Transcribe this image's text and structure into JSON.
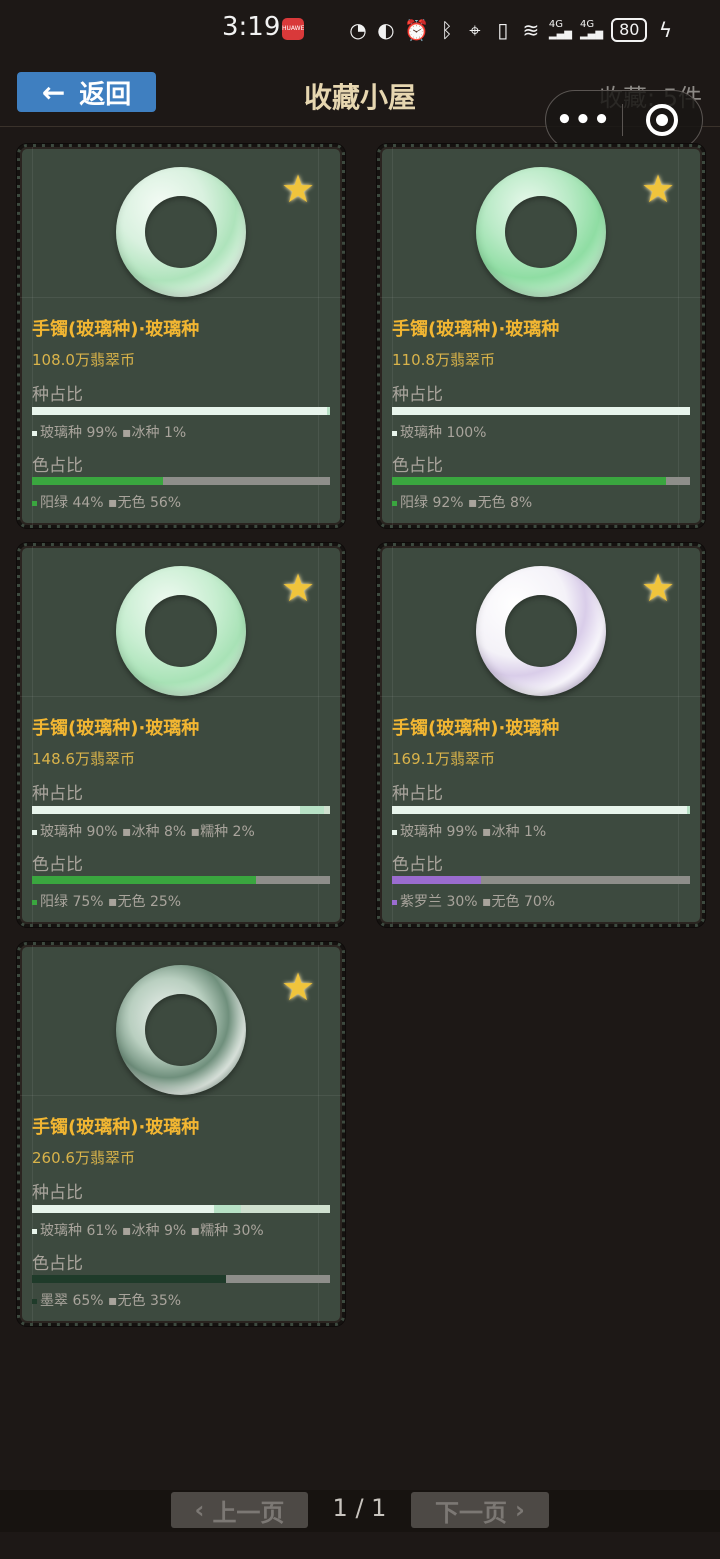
{
  "status_bar": {
    "time": "3:19",
    "app_badge": "HUAWEI",
    "battery": "80",
    "net1": "4G",
    "net2": "4G"
  },
  "header": {
    "back_label": "返回",
    "title": "收藏小屋",
    "count_text": "收藏: 5件"
  },
  "cards": [
    {
      "title": "手镯(玻璃种)·玻璃种",
      "price": "108.0万翡翠币",
      "zhong_label": "种占比",
      "zhong_legend": "玻璃种 99% ▪冰种 1%",
      "se_label": "色占比",
      "se_legend": "阳绿 44% ▪无色 56%",
      "zhong": [
        {
          "name": "玻璃种",
          "pct": 99,
          "color": "#e8f5ec"
        },
        {
          "name": "冰种",
          "pct": 1,
          "color": "#b8e2c6"
        }
      ],
      "se": [
        {
          "name": "阳绿",
          "pct": 44,
          "color": "#3aa63f"
        },
        {
          "name": "无色",
          "pct": 56,
          "color": "#8e8e8a"
        }
      ],
      "jade": "jade-green"
    },
    {
      "title": "手镯(玻璃种)·玻璃种",
      "price": "110.8万翡翠币",
      "zhong_label": "种占比",
      "zhong_legend": "玻璃种 100%",
      "se_label": "色占比",
      "se_legend": "阳绿 92% ▪无色 8%",
      "zhong": [
        {
          "name": "玻璃种",
          "pct": 100,
          "color": "#e8f5ec"
        }
      ],
      "se": [
        {
          "name": "阳绿",
          "pct": 92,
          "color": "#3aa63f"
        },
        {
          "name": "无色",
          "pct": 8,
          "color": "#8e8e8a"
        }
      ],
      "jade": "jade-green-strong"
    },
    {
      "title": "手镯(玻璃种)·玻璃种",
      "price": "148.6万翡翠币",
      "zhong_label": "种占比",
      "zhong_legend": "玻璃种 90% ▪冰种 8% ▪糯种 2%",
      "se_label": "色占比",
      "se_legend": "阳绿 75% ▪无色 25%",
      "zhong": [
        {
          "name": "玻璃种",
          "pct": 90,
          "color": "#e8f5ec"
        },
        {
          "name": "冰种",
          "pct": 8,
          "color": "#b8e2c6"
        },
        {
          "name": "糯种",
          "pct": 2,
          "color": "#cfe0cf"
        }
      ],
      "se": [
        {
          "name": "阳绿",
          "pct": 75,
          "color": "#3aa63f"
        },
        {
          "name": "无色",
          "pct": 25,
          "color": "#8e8e8a"
        }
      ],
      "jade": "jade-green-mid"
    },
    {
      "title": "手镯(玻璃种)·玻璃种",
      "price": "169.1万翡翠币",
      "zhong_label": "种占比",
      "zhong_legend": "玻璃种 99% ▪冰种 1%",
      "se_label": "色占比",
      "se_legend": "紫罗兰 30% ▪无色 70%",
      "zhong": [
        {
          "name": "玻璃种",
          "pct": 99,
          "color": "#e8f5ec"
        },
        {
          "name": "冰种",
          "pct": 1,
          "color": "#b8e2c6"
        }
      ],
      "se": [
        {
          "name": "紫罗兰",
          "pct": 30,
          "color": "#9a6ccf"
        },
        {
          "name": "无色",
          "pct": 70,
          "color": "#8e8e8a"
        }
      ],
      "jade": "jade-lavender"
    },
    {
      "title": "手镯(玻璃种)·玻璃种",
      "price": "260.6万翡翠币",
      "zhong_label": "种占比",
      "zhong_legend": "玻璃种 61% ▪冰种 9% ▪糯种 30%",
      "se_label": "色占比",
      "se_legend": "墨翠 65% ▪无色 35%",
      "zhong": [
        {
          "name": "玻璃种",
          "pct": 61,
          "color": "#e8f5ec"
        },
        {
          "name": "冰种",
          "pct": 9,
          "color": "#b8e2c6"
        },
        {
          "name": "糯种",
          "pct": 30,
          "color": "#cfe0cf"
        }
      ],
      "se": [
        {
          "name": "墨翠",
          "pct": 65,
          "color": "#1f3b2a"
        },
        {
          "name": "无色",
          "pct": 35,
          "color": "#8e8e8a"
        }
      ],
      "jade": "jade-dark"
    }
  ],
  "pager": {
    "prev_label": "上一页",
    "page_text": "1 / 1",
    "next_label": "下一页"
  }
}
